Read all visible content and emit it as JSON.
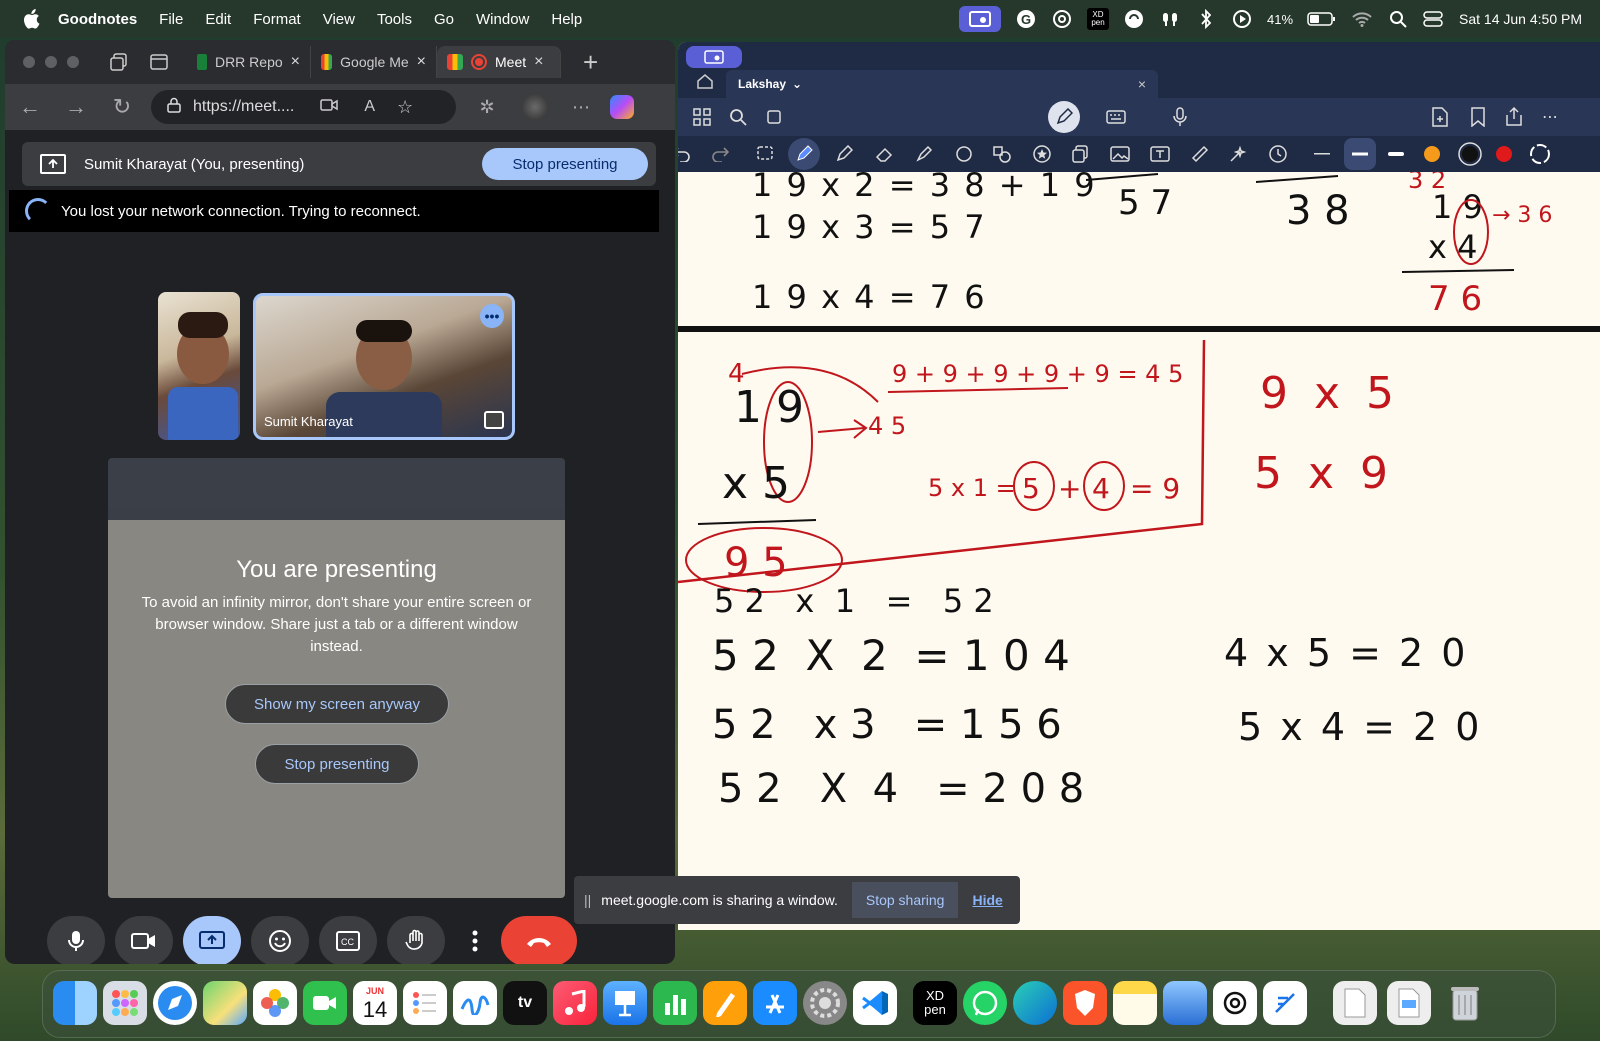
{
  "menubar": {
    "app_name": "Goodnotes",
    "menus": [
      "File",
      "Edit",
      "Format",
      "View",
      "Tools",
      "Go",
      "Window",
      "Help"
    ],
    "battery": "41%",
    "datetime": "Sat 14 Jun  4:50 PM",
    "xd_icon_text": "XD\npen"
  },
  "browser": {
    "tabs": [
      {
        "label": "DRR Repo"
      },
      {
        "label": "Google Me"
      },
      {
        "label": "Meet"
      }
    ],
    "url": "https://meet....",
    "new_tab": "+"
  },
  "meet": {
    "presenting_label": "Sumit Kharayat (You, presenting)",
    "stop_presenting_top": "Stop presenting",
    "network_message": "You lost your network connection. Trying to reconnect.",
    "main_tile_name": "Sumit Kharayat",
    "more_dots": "•••",
    "presenting_title": "You are presenting",
    "presenting_desc": "To avoid an infinity mirror, don't share your entire screen or browser window. Share just a tab or a different window instead.",
    "show_anyway": "Show my screen anyway",
    "stop_presenting": "Stop presenting"
  },
  "share_bar": {
    "pause_glyph": "||",
    "message": "meet.google.com is sharing a window.",
    "stop_sharing": "Stop sharing",
    "hide": "Hide"
  },
  "goodnotes": {
    "tab_title": "Lakshay",
    "tab_chevron": "⌄",
    "colors": {
      "accent": "#c0161c",
      "ink": "#111111",
      "orange": "#f59a1b",
      "red": "#e0191b"
    },
    "notes": {
      "top_left": [
        "1 9  x 2 = 3 8 + 1 9",
        "1 9  x 3 = 5 7",
        "1 9  x 4 = 7 6"
      ],
      "top_mid_1": "5 7",
      "top_mid_2": "3 8",
      "top_right": [
        "3 2",
        "1 9",
        "x 4",
        "7 6",
        "→ 3 6"
      ],
      "mid_sum": "9 + 9 + 9 + 9 + 9 = 4 5",
      "mid_45": "4 5",
      "mid_4": "4",
      "mid_mult": [
        "1 9",
        "x 5",
        "9 5"
      ],
      "mid_eq": "5 x 1 =",
      "mid_eq_5": "5",
      "mid_eq_4": "4",
      "mid_eq_plus": "+",
      "mid_eq_res": "= 9",
      "mid_right": [
        "9 x 5",
        "5 x 9"
      ],
      "bottom_left": [
        "5 2   x  1   =   5 2",
        "5 2  X  2  = 1 0 4",
        "5 2   x 3   = 1 5 6",
        "5 2   X  4   = 2 0 8"
      ],
      "bottom_right": [
        "4 x 5 = 2 0",
        "5 x 4 = 2 0"
      ]
    }
  },
  "dock": {
    "calendar_month": "JUN",
    "calendar_day": "14",
    "tv": "tv",
    "xd": "XD\npen"
  }
}
